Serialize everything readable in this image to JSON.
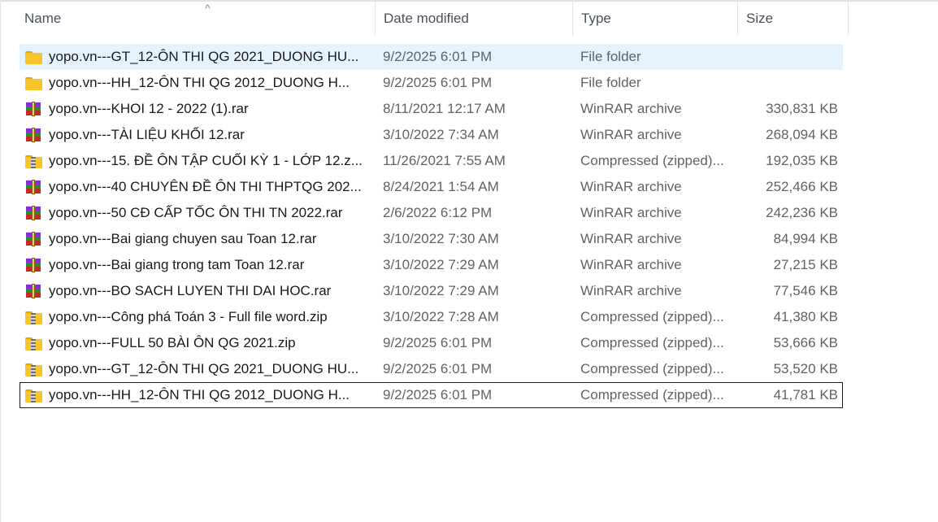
{
  "header": {
    "name": "Name",
    "date": "Date modified",
    "type": "Type",
    "size": "Size",
    "sort_indicator": "^"
  },
  "files": [
    {
      "icon": "folder-icon",
      "name": "yopo.vn---GT_12-ÔN THI QG 2021_DUONG HU...",
      "date": "9/2/2025 6:01 PM",
      "type": "File folder",
      "size": "",
      "state": "selected"
    },
    {
      "icon": "folder-icon",
      "name": "yopo.vn---HH_12-ÔN THI QG 2012_DUONG H...",
      "date": "9/2/2025 6:01 PM",
      "type": "File folder",
      "size": "",
      "state": ""
    },
    {
      "icon": "rar-icon",
      "name": "yopo.vn---KHOI 12 - 2022 (1).rar",
      "date": "8/11/2021 12:17 AM",
      "type": "WinRAR archive",
      "size": "330,831 KB",
      "state": ""
    },
    {
      "icon": "rar-icon",
      "name": "yopo.vn---TÀI LIỆU KHỐI 12.rar",
      "date": "3/10/2022 7:34 AM",
      "type": "WinRAR archive",
      "size": "268,094 KB",
      "state": ""
    },
    {
      "icon": "zip-icon",
      "name": "yopo.vn---15. ĐỀ ÔN TẬP CUỐI KỲ 1 - LỚP 12.z...",
      "date": "11/26/2021 7:55 AM",
      "type": "Compressed (zipped)...",
      "size": "192,035 KB",
      "state": ""
    },
    {
      "icon": "rar-icon",
      "name": "yopo.vn---40 CHUYÊN ĐỀ ÔN THI THPTQG 202...",
      "date": "8/24/2021 1:54 AM",
      "type": "WinRAR archive",
      "size": "252,466 KB",
      "state": ""
    },
    {
      "icon": "rar-icon",
      "name": "yopo.vn---50 CĐ CẤP TỐC ÔN THI TN 2022.rar",
      "date": "2/6/2022 6:12 PM",
      "type": "WinRAR archive",
      "size": "242,236 KB",
      "state": ""
    },
    {
      "icon": "rar-icon",
      "name": "yopo.vn---Bai giang chuyen sau Toan 12.rar",
      "date": "3/10/2022 7:30 AM",
      "type": "WinRAR archive",
      "size": "84,994 KB",
      "state": ""
    },
    {
      "icon": "rar-icon",
      "name": "yopo.vn---Bai giang trong tam Toan 12.rar",
      "date": "3/10/2022 7:29 AM",
      "type": "WinRAR archive",
      "size": "27,215 KB",
      "state": ""
    },
    {
      "icon": "rar-icon",
      "name": "yopo.vn---BO SACH LUYEN THI DAI HOC.rar",
      "date": "3/10/2022 7:29 AM",
      "type": "WinRAR archive",
      "size": "77,546 KB",
      "state": ""
    },
    {
      "icon": "zip-icon",
      "name": "yopo.vn---Công phá Toán 3 - Full file word.zip",
      "date": "3/10/2022 7:28 AM",
      "type": "Compressed (zipped)...",
      "size": "41,380 KB",
      "state": ""
    },
    {
      "icon": "zip-icon",
      "name": "yopo.vn---FULL 50 BÀI ÔN QG 2021.zip",
      "date": "9/2/2025 6:01 PM",
      "type": "Compressed (zipped)...",
      "size": "53,666 KB",
      "state": ""
    },
    {
      "icon": "zip-icon",
      "name": "yopo.vn---GT_12-ÔN THI QG 2021_DUONG HU...",
      "date": "9/2/2025 6:01 PM",
      "type": "Compressed (zipped)...",
      "size": "53,520 KB",
      "state": ""
    },
    {
      "icon": "zip-icon",
      "name": "yopo.vn---HH_12-ÔN THI QG 2012_DUONG H...",
      "date": "9/2/2025 6:01 PM",
      "type": "Compressed (zipped)...",
      "size": "41,781 KB",
      "state": "focused"
    }
  ],
  "colors": {
    "selected_row_bg": "#e5f3ff",
    "header_text": "#4a5060",
    "secondary_text": "#5f6368"
  }
}
